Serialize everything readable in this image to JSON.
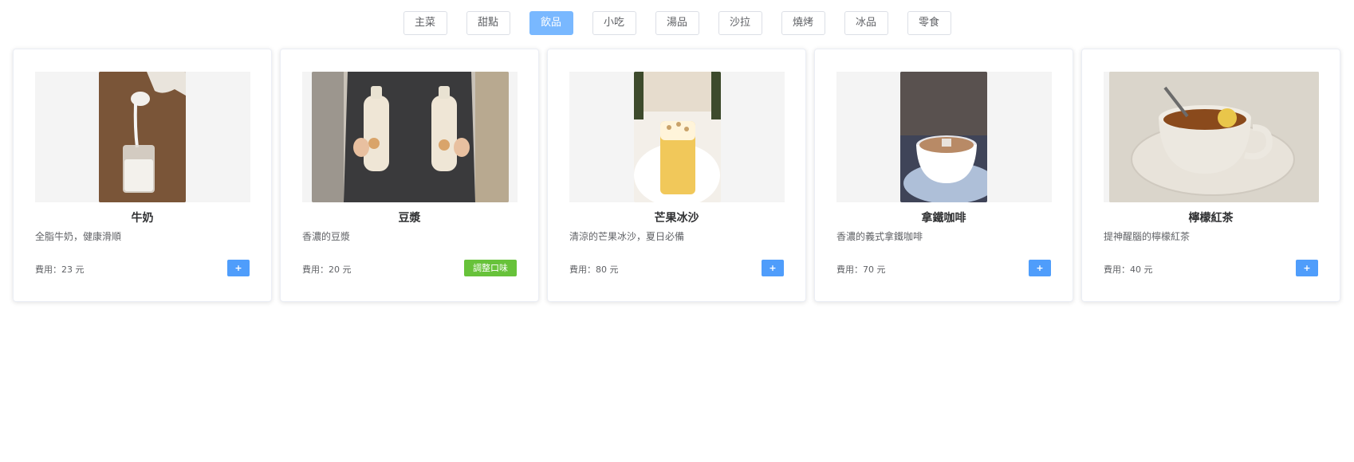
{
  "categories": [
    "主菜",
    "甜點",
    "飲品",
    "小吃",
    "湯品",
    "沙拉",
    "燒烤",
    "冰品",
    "零食"
  ],
  "active_category": "飲品",
  "items": [
    {
      "name": "牛奶",
      "desc": "全脂牛奶，健康滑順",
      "price": "費用：23 元",
      "action": "+",
      "action_type": "add"
    },
    {
      "name": "豆漿",
      "desc": "香濃的豆漿",
      "price": "費用：20 元",
      "action": "調整口味",
      "action_type": "flavor"
    },
    {
      "name": "芒果冰沙",
      "desc": "清涼的芒果冰沙，夏日必備",
      "price": "費用：80 元",
      "action": "+",
      "action_type": "add"
    },
    {
      "name": "拿鐵咖啡",
      "desc": "香濃的義式拿鐵咖啡",
      "price": "費用：70 元",
      "action": "+",
      "action_type": "add"
    },
    {
      "name": "檸檬紅茶",
      "desc": "提神醒腦的檸檬紅茶",
      "price": "費用：40 元",
      "action": "+",
      "action_type": "add"
    }
  ],
  "colors": {
    "active_tab": "#79b8ff",
    "add_button": "#4f9dfb",
    "flavor_button": "#67c23a"
  }
}
